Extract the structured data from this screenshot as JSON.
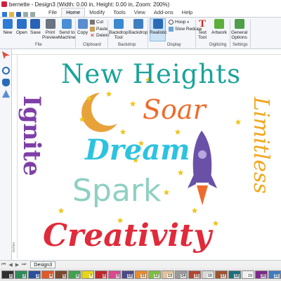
{
  "window": {
    "title": "bernette - Design3 (Width: 0.00 in, Height: 0.00 in, Zoom: 200%)"
  },
  "menu": {
    "tabs": [
      "File",
      "Home",
      "Modify",
      "Tools",
      "View",
      "Add-ons",
      "Help"
    ],
    "active": "Home"
  },
  "ribbon": {
    "file_group": {
      "label": "File",
      "new": "New",
      "open": "Open",
      "save": "Save",
      "print": "Print\nPreview",
      "send": "Send to\nMachine"
    },
    "clipboard_group": {
      "label": "Clipboard",
      "copy": "Copy",
      "cut": "Cut",
      "paste": "Paste",
      "delete": "Delete"
    },
    "backdrop_group": {
      "label": "Backdrop",
      "backdrop_tool": "Backdrop\nTool",
      "backdrop": "Backdrop"
    },
    "display_group": {
      "label": "Display",
      "realistic": "Realistic",
      "hoop": "Hoop",
      "slow_redraw": "Slow Redraw"
    },
    "digitizing_group": {
      "label": "Digitizing",
      "text_tool": "Text\nTool",
      "artwork": "Artwork"
    },
    "settings_group": {
      "label": "Settings",
      "general_options": "General\nOptions"
    }
  },
  "ruler": {
    "left_label": "inches"
  },
  "design": {
    "words": [
      "New Heights",
      "Ignite",
      "Soar",
      "Dream",
      "Spark",
      "Limitless",
      "Creativity"
    ],
    "colors": {
      "new_heights": "#1aa39a",
      "ignite": "#7e3fa8",
      "soar": "#ef6b2d",
      "dream": "#2cc3e0",
      "spark": "#8fd0c3",
      "limitless": "#f2a61b",
      "creativity": "#e12a3a",
      "moon": "#e8a23a",
      "star": "#f0c419",
      "rocket": "#6a51a8"
    }
  },
  "tabs": {
    "design_tab": "Design3",
    "nav_first": "⏮",
    "nav_prev": "◀",
    "nav_next": "▶",
    "nav_last": "⏭"
  },
  "palette": [
    {
      "n": "1",
      "c": "#2f2f2f"
    },
    {
      "n": "2",
      "c": "#2e8b57"
    },
    {
      "n": "3",
      "c": "#2a4fa0"
    },
    {
      "n": "4",
      "c": "#e05a2b"
    },
    {
      "n": "5",
      "c": "#7a4a2e"
    },
    {
      "n": "6",
      "c": "#3fa34d"
    },
    {
      "n": "7",
      "c": "#e6d51d"
    },
    {
      "n": "8",
      "c": "#c1272d"
    },
    {
      "n": "9",
      "c": "#d94891"
    },
    {
      "n": "10",
      "c": "#4a4a8a"
    },
    {
      "n": "11",
      "c": "#e88b2e"
    },
    {
      "n": "12",
      "c": "#7fbf3f"
    },
    {
      "n": "13",
      "c": "#e2c3a0"
    },
    {
      "n": "14",
      "c": "#9a9a9a"
    },
    {
      "n": "15",
      "c": "#b5462f"
    },
    {
      "n": "16",
      "c": "#d8d8d8"
    },
    {
      "n": "17",
      "c": "#a0522d"
    },
    {
      "n": "18",
      "c": "#1f6f7a"
    },
    {
      "n": "19",
      "c": "#f0f0f0"
    },
    {
      "n": "20",
      "c": "#7c2a8a"
    },
    {
      "n": "21",
      "c": "#3c7dc4"
    }
  ]
}
